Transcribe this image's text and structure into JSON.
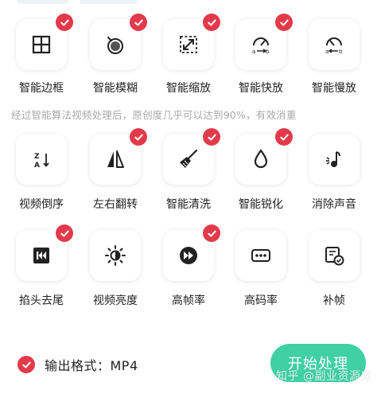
{
  "row1": [
    {
      "label": "智能边框",
      "checked": true,
      "icon": "border-frame-icon"
    },
    {
      "label": "智能模糊",
      "checked": true,
      "icon": "blur-lens-icon"
    },
    {
      "label": "智能缩放",
      "checked": true,
      "icon": "zoom-arrows-icon"
    },
    {
      "label": "智能快放",
      "checked": true,
      "icon": "speed-fast-icon"
    },
    {
      "label": "智能慢放",
      "checked": true,
      "icon": "speed-slow-icon"
    }
  ],
  "description": "经过智能算法视频处理后，原创度几乎可以达到90%，有效消重",
  "row2": [
    {
      "label": "视频倒序",
      "checked": false,
      "icon": "sort-za-icon"
    },
    {
      "label": "左右翻转",
      "checked": true,
      "icon": "flip-horizontal-icon"
    },
    {
      "label": "智能清洗",
      "checked": true,
      "icon": "broom-icon"
    },
    {
      "label": "智能锐化",
      "checked": true,
      "icon": "droplet-icon"
    },
    {
      "label": "消除声音",
      "checked": false,
      "icon": "mute-note-icon"
    }
  ],
  "row3": [
    {
      "label": "掐头去尾",
      "checked": true,
      "icon": "skip-start-icon"
    },
    {
      "label": "视频亮度",
      "checked": false,
      "icon": "brightness-icon"
    },
    {
      "label": "高帧率",
      "checked": true,
      "icon": "fast-forward-circle-icon"
    },
    {
      "label": "高码率",
      "checked": false,
      "icon": "bitrate-dots-icon"
    },
    {
      "label": "补帧",
      "checked": false,
      "icon": "frame-fill-icon"
    }
  ],
  "footer": {
    "format_label": "输出格式：MP4",
    "format_checked": true,
    "start_button": "开始处理",
    "watermark": "知乎 @副业资源库"
  },
  "colors": {
    "check": "#e23a4a",
    "button": "#3fd0a3",
    "description": "#a8a8a8"
  }
}
